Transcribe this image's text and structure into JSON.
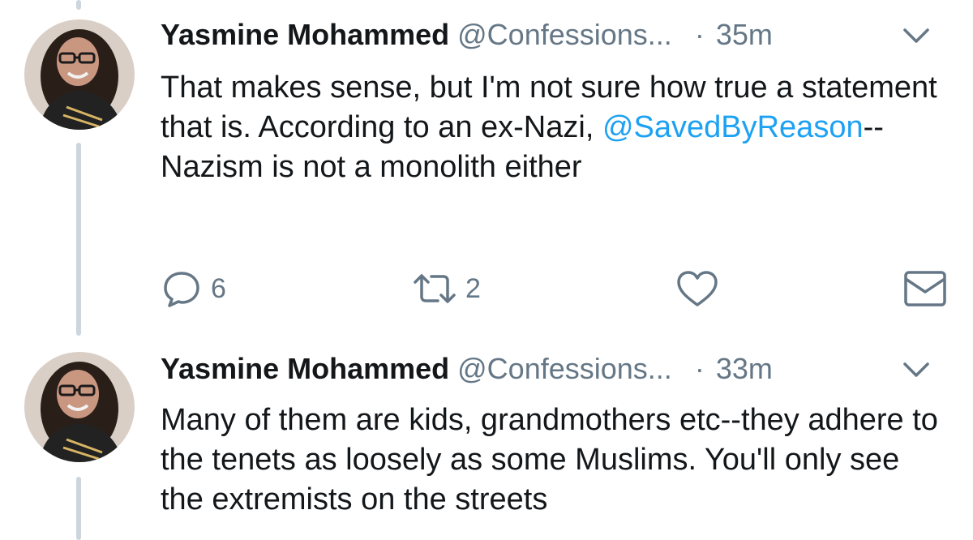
{
  "tweets": [
    {
      "author": "Yasmine Mohammed",
      "handle": "@Confessions...",
      "separator": "·",
      "time": "35m",
      "text_parts": {
        "before_mention": "That makes sense, but I'm not sure how true a statement that is. According to an ex-Nazi, ",
        "mention": "@SavedByReason",
        "after_mention": "--Nazism is not a monolith either"
      },
      "actions": {
        "replies": "6",
        "retweets": "2"
      }
    },
    {
      "author": "Yasmine Mohammed",
      "handle": "@Confessions...",
      "separator": "·",
      "time": "33m",
      "text": "Many of them are kids, grandmothers etc--they adhere to the tenets as loosely as some Muslims. You'll only see the extremists on the streets"
    }
  ],
  "icons": {
    "reply": "speech-bubble-icon",
    "retweet": "retweet-arrows-icon",
    "like": "heart-icon",
    "dm": "envelope-icon",
    "menu": "chevron-down-icon"
  },
  "colors": {
    "text": "#14171a",
    "muted": "#657786",
    "link": "#1da1f2",
    "thread_line": "#ccd6dd"
  }
}
